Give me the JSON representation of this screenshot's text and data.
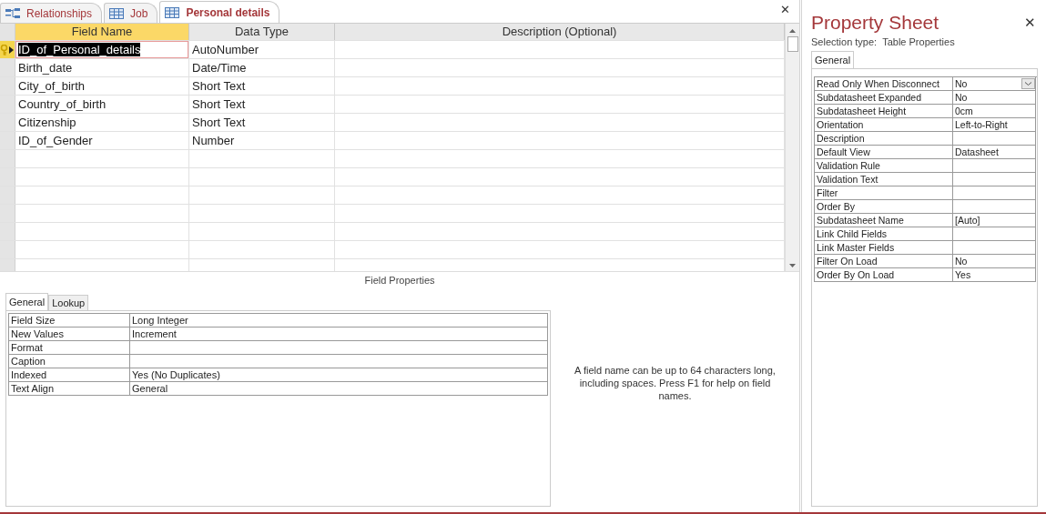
{
  "close_symbol": "✕",
  "document_tabs": [
    {
      "label": "Relationships",
      "kind": "relationships",
      "selected": false
    },
    {
      "label": "Job",
      "kind": "table",
      "selected": false
    },
    {
      "label": "Personal details",
      "kind": "table",
      "selected": true
    }
  ],
  "design_grid": {
    "columns": [
      "Field Name",
      "Data Type",
      "Description (Optional)"
    ],
    "rows": [
      {
        "field_name": "ID_of_Personal_details",
        "data_type": "AutoNumber",
        "primary_key": true,
        "selected": true
      },
      {
        "field_name": "Birth_date",
        "data_type": "Date/Time",
        "primary_key": false,
        "selected": false
      },
      {
        "field_name": "City_of_birth",
        "data_type": "Short Text",
        "primary_key": false,
        "selected": false
      },
      {
        "field_name": "Country_of_birth",
        "data_type": "Short Text",
        "primary_key": false,
        "selected": false
      },
      {
        "field_name": "Citizenship",
        "data_type": "Short Text",
        "primary_key": false,
        "selected": false
      },
      {
        "field_name": "ID_of_Gender",
        "data_type": "Number",
        "primary_key": false,
        "selected": false
      }
    ]
  },
  "field_properties": {
    "title": "Field Properties",
    "tabs": [
      {
        "label": "General",
        "selected": true
      },
      {
        "label": "Lookup",
        "selected": false
      }
    ],
    "rows": [
      {
        "name": "Field Size",
        "value": "Long Integer"
      },
      {
        "name": "New Values",
        "value": "Increment"
      },
      {
        "name": "Format",
        "value": ""
      },
      {
        "name": "Caption",
        "value": ""
      },
      {
        "name": "Indexed",
        "value": "Yes (No Duplicates)"
      },
      {
        "name": "Text Align",
        "value": "General"
      }
    ],
    "help": "A field name can be up to 64 characters long, including spaces. Press F1 for help on field names."
  },
  "property_sheet": {
    "title": "Property Sheet",
    "selection_label": "Selection type:",
    "selection_type": "Table Properties",
    "tabs": [
      {
        "label": "General",
        "selected": true
      }
    ],
    "rows": [
      {
        "name": "Read Only When Disconnect",
        "value": "No",
        "dropdown": true
      },
      {
        "name": "Subdatasheet Expanded",
        "value": "No"
      },
      {
        "name": "Subdatasheet Height",
        "value": "0cm"
      },
      {
        "name": "Orientation",
        "value": "Left-to-Right"
      },
      {
        "name": "Description",
        "value": ""
      },
      {
        "name": "Default View",
        "value": "Datasheet"
      },
      {
        "name": "Validation Rule",
        "value": ""
      },
      {
        "name": "Validation Text",
        "value": ""
      },
      {
        "name": "Filter",
        "value": ""
      },
      {
        "name": "Order By",
        "value": ""
      },
      {
        "name": "Subdatasheet Name",
        "value": "[Auto]"
      },
      {
        "name": "Link Child Fields",
        "value": ""
      },
      {
        "name": "Link Master Fields",
        "value": ""
      },
      {
        "name": "Filter On Load",
        "value": "No"
      },
      {
        "name": "Order By On Load",
        "value": "Yes"
      }
    ]
  }
}
